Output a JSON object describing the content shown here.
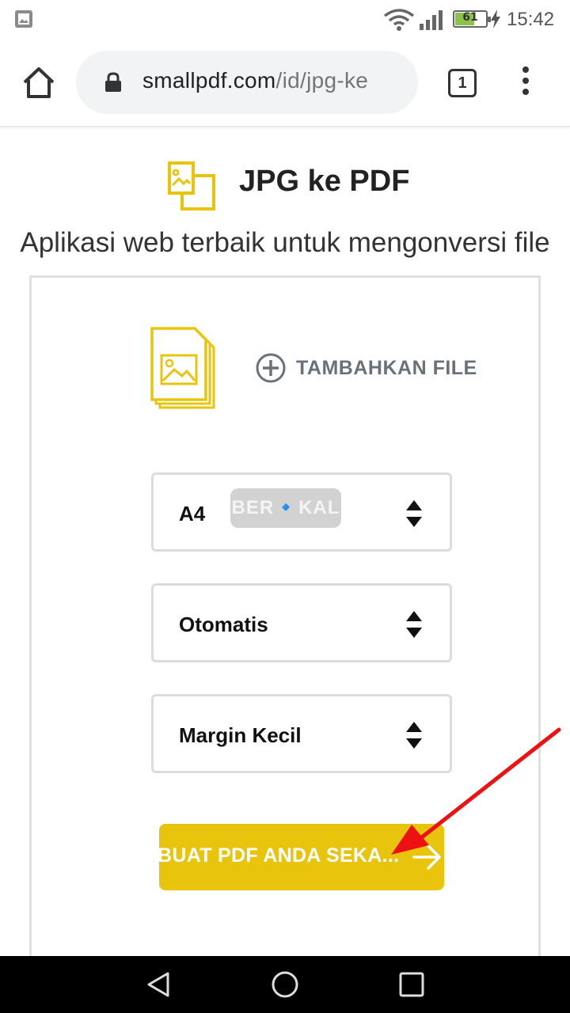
{
  "status_bar": {
    "battery_level": "61",
    "time": "15:42"
  },
  "browser": {
    "url_host": "smallpdf.com",
    "url_path": "/id/jpg-ke",
    "tab_count": "1"
  },
  "page": {
    "title": "JPG ke PDF",
    "subtitle": "Aplikasi web terbaik untuk mengonversi file JPG ke PDF"
  },
  "uploader": {
    "add_file_label": "TAMBAHKAN FILE"
  },
  "options": {
    "page_size": "A4",
    "orientation": "Otomatis",
    "margin": "Margin Kecil"
  },
  "watermark": {
    "text": "BER🔹KAL"
  },
  "action": {
    "convert_label": "BUAT PDF ANDA SEKA..."
  },
  "colors": {
    "accent": "#e8c50c",
    "annotation": "#ee1111"
  }
}
